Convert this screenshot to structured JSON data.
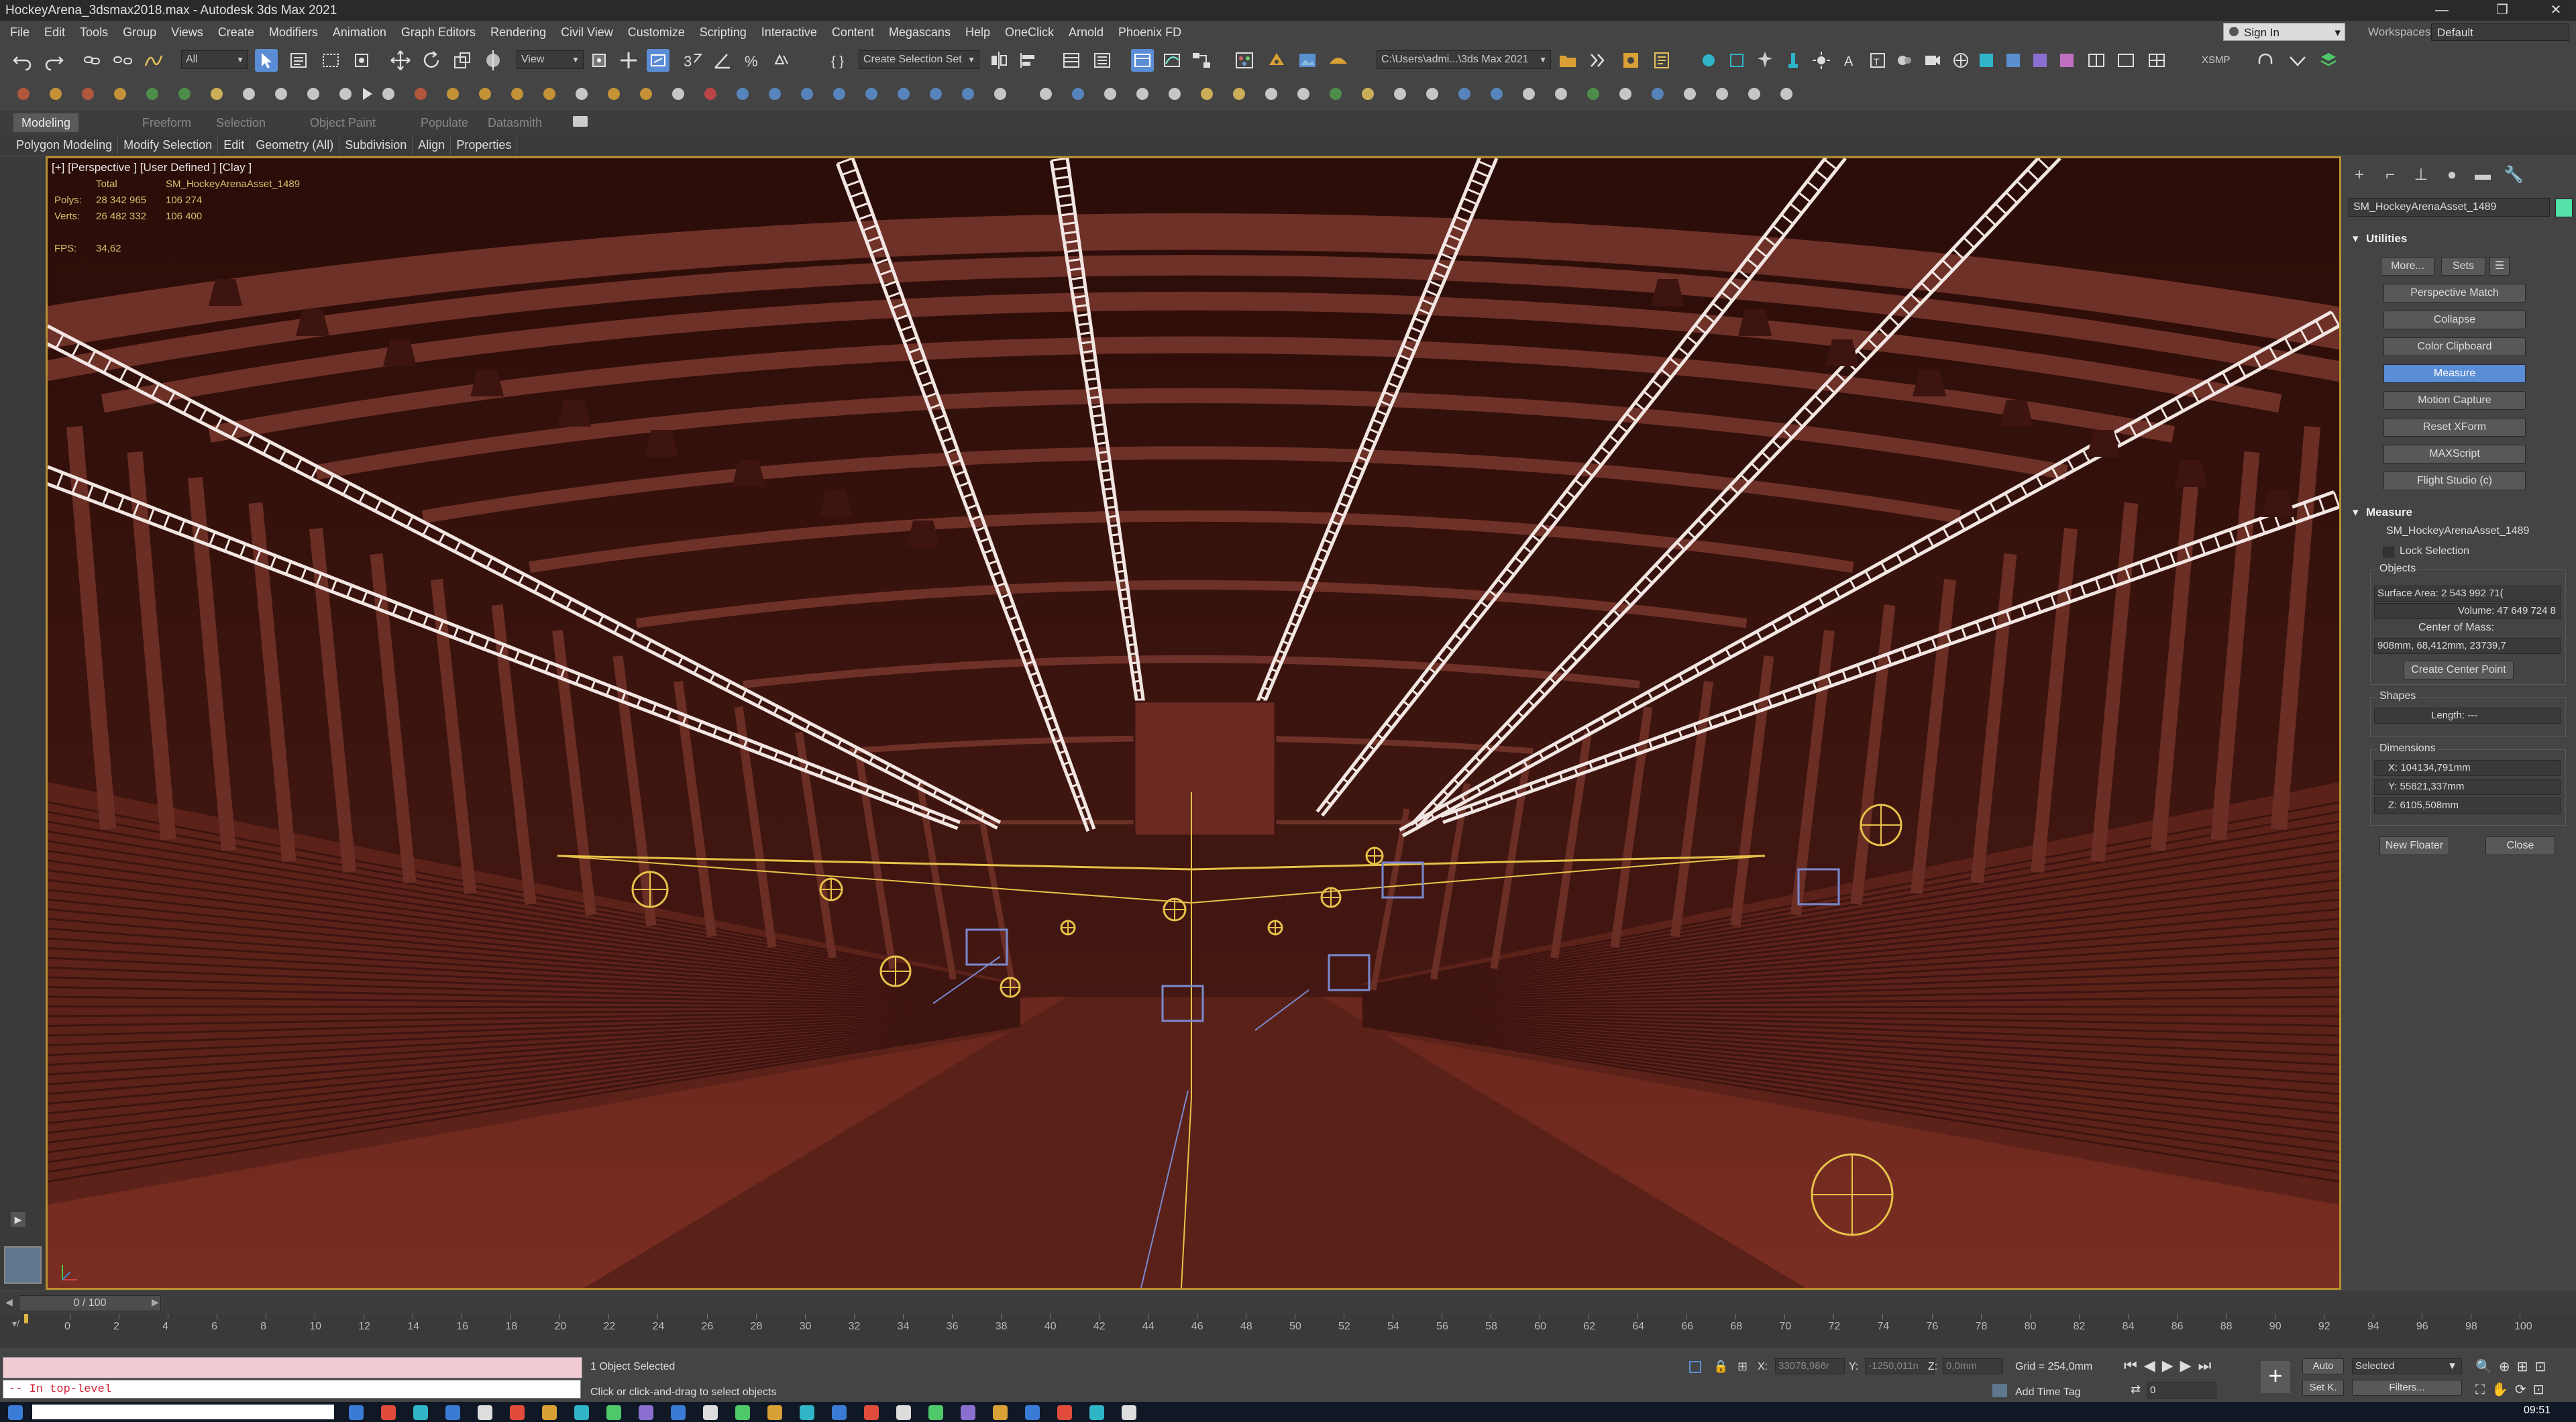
{
  "window": {
    "title": "HockeyArena_3dsmax2018.max - Autodesk 3ds Max 2021",
    "controls": [
      "—",
      "❐",
      "✕"
    ]
  },
  "menubar": {
    "items": [
      "File",
      "Edit",
      "Tools",
      "Group",
      "Views",
      "Create",
      "Modifiers",
      "Animation",
      "Graph Editors",
      "Rendering",
      "Civil View",
      "Customize",
      "Scripting",
      "Interactive",
      "Content",
      "Megascans",
      "Help",
      "OneClick",
      "Arnold",
      "Phoenix FD"
    ],
    "signin": "Sign In",
    "workspaces_label": "Workspaces:",
    "workspaces_value": "Default"
  },
  "toolbar": {
    "selection_filter": "All",
    "ref_coord": "View",
    "selection_set": "Create Selection Set",
    "project_path": "C:\\Users\\admi...\\3ds Max 2021",
    "xsmp": "XSMP"
  },
  "ribbon": {
    "tabs": [
      "Modeling",
      "Freeform",
      "Selection",
      "Object Paint",
      "Populate",
      "Datasmith"
    ],
    "subtabs": [
      "Polygon Modeling",
      "Modify Selection",
      "Edit",
      "Geometry (All)",
      "Subdivision",
      "Align",
      "Properties"
    ]
  },
  "viewport": {
    "label": "[+] [Perspective ] [User Defined ] [Clay ]",
    "stats_header_total": "Total",
    "stats_header_obj": "SM_HockeyArenaAsset_1489",
    "polys_label": "Polys:",
    "polys_total": "28 342 965",
    "polys_obj": "106 274",
    "verts_label": "Verts:",
    "verts_total": "26 482 332",
    "verts_obj": "106 400",
    "fps_label": "FPS:",
    "fps_value": "34,62",
    "bg_color": "#4d1b14"
  },
  "command_panel": {
    "object_name": "SM_HockeyArenaAsset_1489",
    "utilities_title": "Utilities",
    "more_btn": "More...",
    "sets_btn": "Sets",
    "utility_buttons": [
      "Perspective Match",
      "Collapse",
      "Color Clipboard",
      "Measure",
      "Motion Capture",
      "Reset XForm",
      "MAXScript",
      "Flight Studio (c)"
    ],
    "active_utility": "Measure",
    "measure": {
      "title": "Measure",
      "object": "SM_HockeyArenaAsset_1489",
      "lock_selection": "Lock Selection",
      "objects_label": "Objects",
      "surface_area": "Surface Area: 2 543 992 71(",
      "volume": "Volume: 47 649 724 8",
      "center_of_mass_label": "Center of Mass:",
      "center_of_mass": "908mm, 68,412mm, 23739,7",
      "create_center_point": "Create Center Point",
      "shapes_label": "Shapes",
      "length": "Length: ---",
      "dimensions_label": "Dimensions",
      "dim_x": "X: 104134,791mm",
      "dim_y": "Y: 55821,337mm",
      "dim_z": "Z: 6105,508mm",
      "new_floater": "New Floater",
      "close": "Close"
    }
  },
  "timeline": {
    "frame_indicator": "0 / 100",
    "ticks": [
      "0",
      "2",
      "4",
      "6",
      "8",
      "10",
      "12",
      "14",
      "16",
      "18",
      "20",
      "22",
      "24",
      "26",
      "28",
      "30",
      "32",
      "34",
      "36",
      "38",
      "40",
      "42",
      "44",
      "46",
      "48",
      "50",
      "52",
      "54",
      "56",
      "58",
      "60",
      "62",
      "64",
      "66",
      "68",
      "70",
      "72",
      "74",
      "76",
      "78",
      "80",
      "82",
      "84",
      "86",
      "88",
      "90",
      "92",
      "94",
      "96",
      "98",
      "100"
    ]
  },
  "status": {
    "maxscript_text": "-- In top-level",
    "objects_selected": "1 Object Selected",
    "prompt": "Click or click-and-drag to select objects",
    "x_label": "X:",
    "x_value": "33078,986r",
    "y_label": "Y:",
    "y_value": "-1250,011n",
    "z_label": "Z:",
    "z_value": "0,0mm",
    "grid": "Grid = 254,0mm",
    "add_time_tag": "Add Time Tag",
    "auto": "Auto",
    "set_key": "Set K.",
    "selected": "Selected",
    "filters": "Filters...",
    "frame": "0",
    "clock": "09:51"
  }
}
